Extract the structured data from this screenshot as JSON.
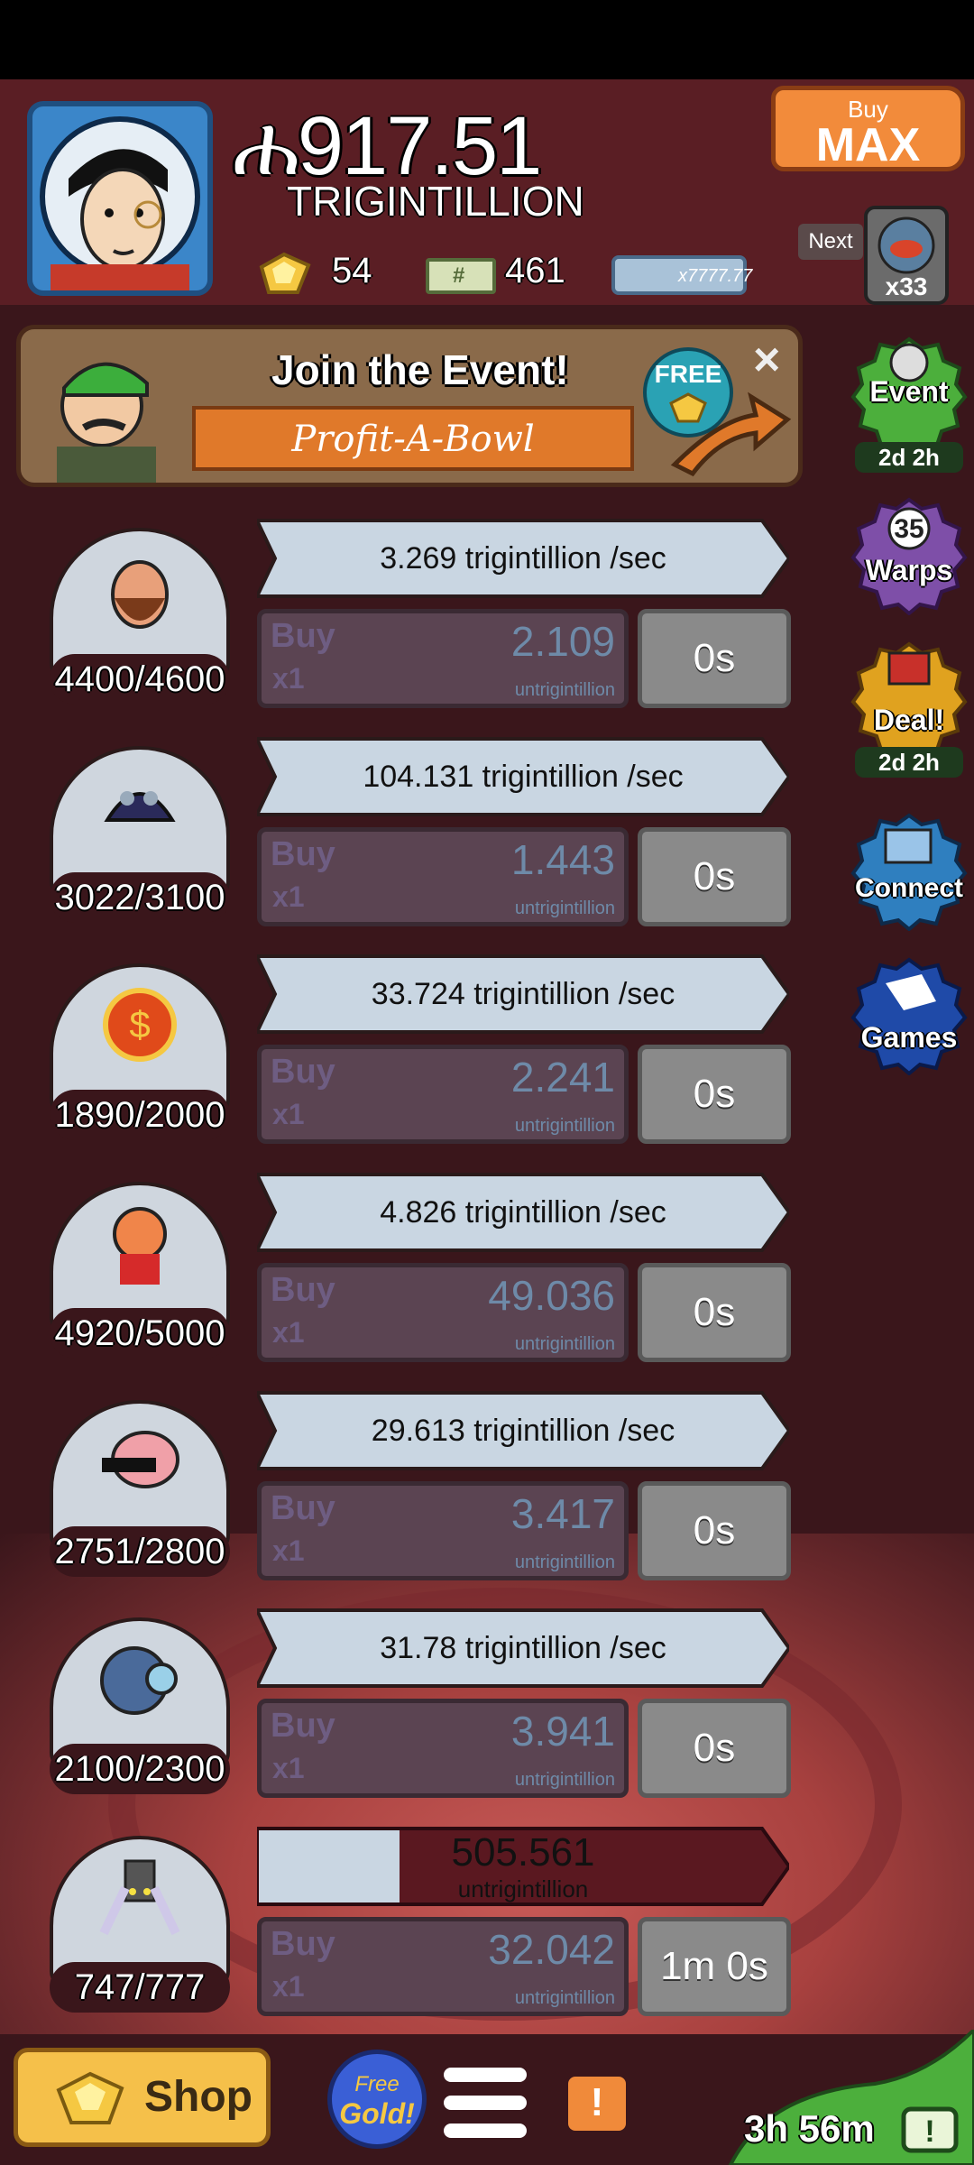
{
  "header": {
    "currency_symbol": "ሐ",
    "money_value": "917.51",
    "money_unit": "TRIGINTILLION",
    "gold_count": "54",
    "megabucks_count": "461",
    "bill_text": "x7777.77",
    "buy_max": {
      "top": "Buy",
      "bottom": "MAX"
    },
    "next_label": "Next",
    "next_multiplier": "x33"
  },
  "event_banner": {
    "title": "Join the Event!",
    "subtitle": "Profit-A-Bowl",
    "free_tag": "FREE",
    "close": "×"
  },
  "side_buttons": [
    {
      "label": "Event",
      "timer": "2d 2h",
      "color": "#4caf3c"
    },
    {
      "label": "Warps",
      "badge": "35",
      "color": "#7e4fa8"
    },
    {
      "label": "Deal!",
      "timer": "2d 2h",
      "color": "#e0a21f"
    },
    {
      "label": "Connect",
      "color": "#2f7fbf"
    },
    {
      "label": "Games",
      "color": "#1f4aa8"
    }
  ],
  "rows": [
    {
      "rate": "3.269 trigintillion /sec",
      "buy": "Buy",
      "mult": "x1",
      "cost": "2.109",
      "cost_unit": "untrigintillion",
      "timer": "0s",
      "owned": "4400/4600",
      "progress": 0.956
    },
    {
      "rate": "104.131 trigintillion /sec",
      "buy": "Buy",
      "mult": "x1",
      "cost": "1.443",
      "cost_unit": "untrigintillion",
      "timer": "0s",
      "owned": "3022/3100",
      "progress": 0.975
    },
    {
      "rate": "33.724 trigintillion /sec",
      "buy": "Buy",
      "mult": "x1",
      "cost": "2.241",
      "cost_unit": "untrigintillion",
      "timer": "0s",
      "owned": "1890/2000",
      "progress": 0.945
    },
    {
      "rate": "4.826 trigintillion /sec",
      "buy": "Buy",
      "mult": "x1",
      "cost": "49.036",
      "cost_unit": "untrigintillion",
      "timer": "0s",
      "owned": "4920/5000",
      "progress": 0.984
    },
    {
      "rate": "29.613 trigintillion /sec",
      "buy": "Buy",
      "mult": "x1",
      "cost": "3.417",
      "cost_unit": "untrigintillion",
      "timer": "0s",
      "owned": "2751/2800",
      "progress": 0.982
    },
    {
      "rate": "31.78 trigintillion /sec",
      "buy": "Buy",
      "mult": "x1",
      "cost": "3.941",
      "cost_unit": "untrigintillion",
      "timer": "0s",
      "owned": "2100/2300",
      "progress": 0.913
    },
    {
      "rate": "505.561",
      "rate_unit": "untrigintillion",
      "buy": "Buy",
      "mult": "x1",
      "cost": "32.042",
      "cost_unit": "untrigintillion",
      "timer": "1m 0s",
      "owned": "747/777",
      "progress": 0.961,
      "bar_fill": 0.28
    }
  ],
  "bottom": {
    "shop": "Shop",
    "free_gold_top": "Free",
    "free_gold_bottom": "Gold!",
    "alert": "!",
    "countdown": "3h 56m"
  }
}
